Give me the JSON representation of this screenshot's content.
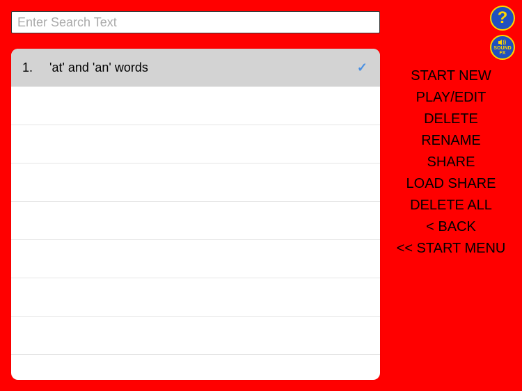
{
  "search": {
    "placeholder": "Enter Search Text",
    "value": ""
  },
  "list": {
    "items": [
      {
        "number": "1.",
        "label": "'at' and 'an' words",
        "selected": true
      }
    ]
  },
  "menu": {
    "items": [
      "START NEW",
      "PLAY/EDIT",
      "DELETE",
      "RENAME",
      "SHARE",
      "LOAD SHARE",
      "DELETE ALL",
      "< BACK",
      "<< START MENU"
    ]
  },
  "icons": {
    "help": "?",
    "sound_label_1": "SOUND",
    "sound_label_2": "FX"
  },
  "checkmark": "✓"
}
